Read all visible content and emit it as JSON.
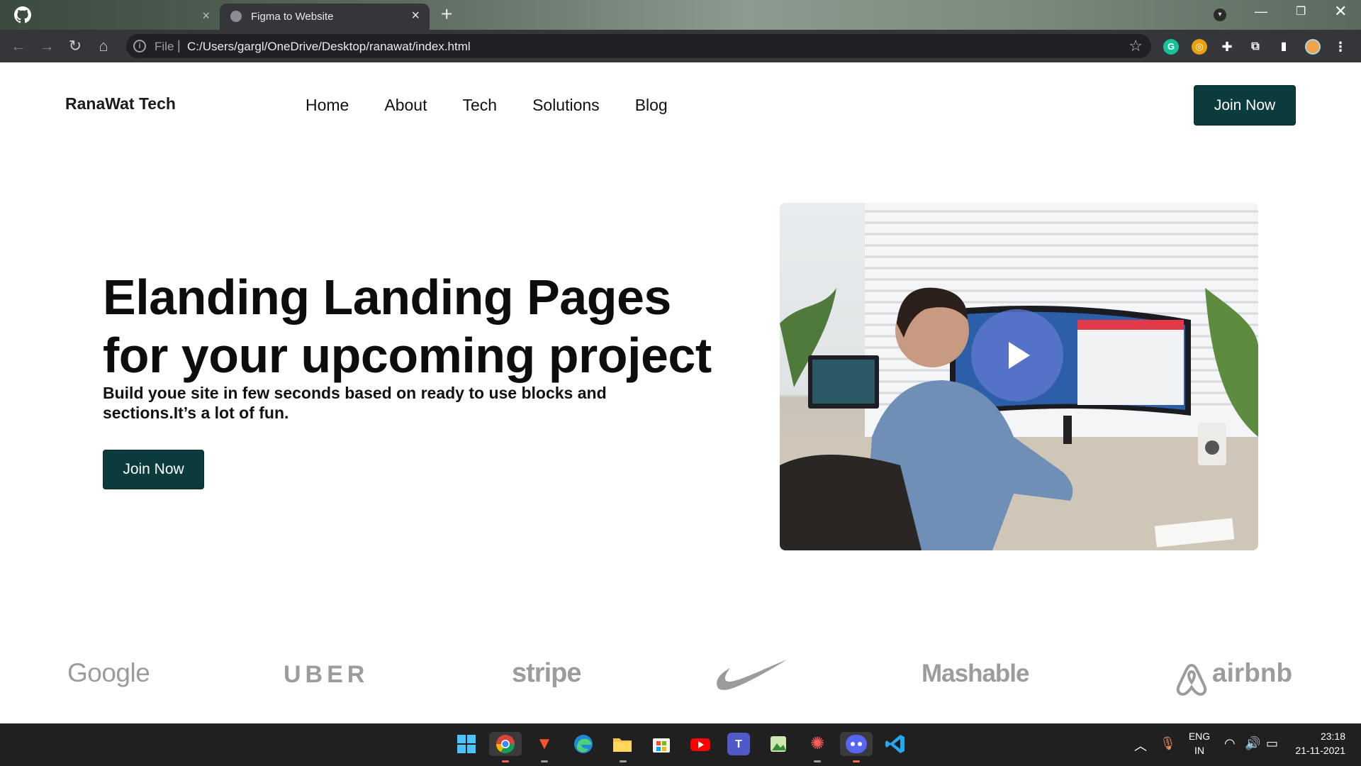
{
  "browser": {
    "tab_title": "Figma to Website",
    "url_scheme_label": "File",
    "url": "C:/Users/gargl/OneDrive/Desktop/ranawat/index.html",
    "new_tab_symbol": "+",
    "close_symbol": "×"
  },
  "site": {
    "brand": "RanaWat Tech",
    "nav": [
      "Home",
      "About",
      "Tech",
      "Solutions",
      "Blog"
    ],
    "join_top": "Join Now",
    "hero": {
      "title_line1": "Elanding Landing Pages",
      "title_line2": "for your upcoming project",
      "subtitle": "Build youe site in few seconds based on ready to use blocks and sections.It’s a lot of fun.",
      "cta": "Join Now"
    },
    "logos": [
      "Google",
      "UBER",
      "stripe",
      "Nike",
      "Mashable",
      "airbnb"
    ]
  },
  "taskbar": {
    "lang_line1": "ENG",
    "lang_line2": "IN",
    "time": "23:18",
    "date": "21-11-2021"
  },
  "colors": {
    "accent": "#0b3b3d",
    "chrome_dark": "#35363a",
    "taskbar": "#202020"
  }
}
